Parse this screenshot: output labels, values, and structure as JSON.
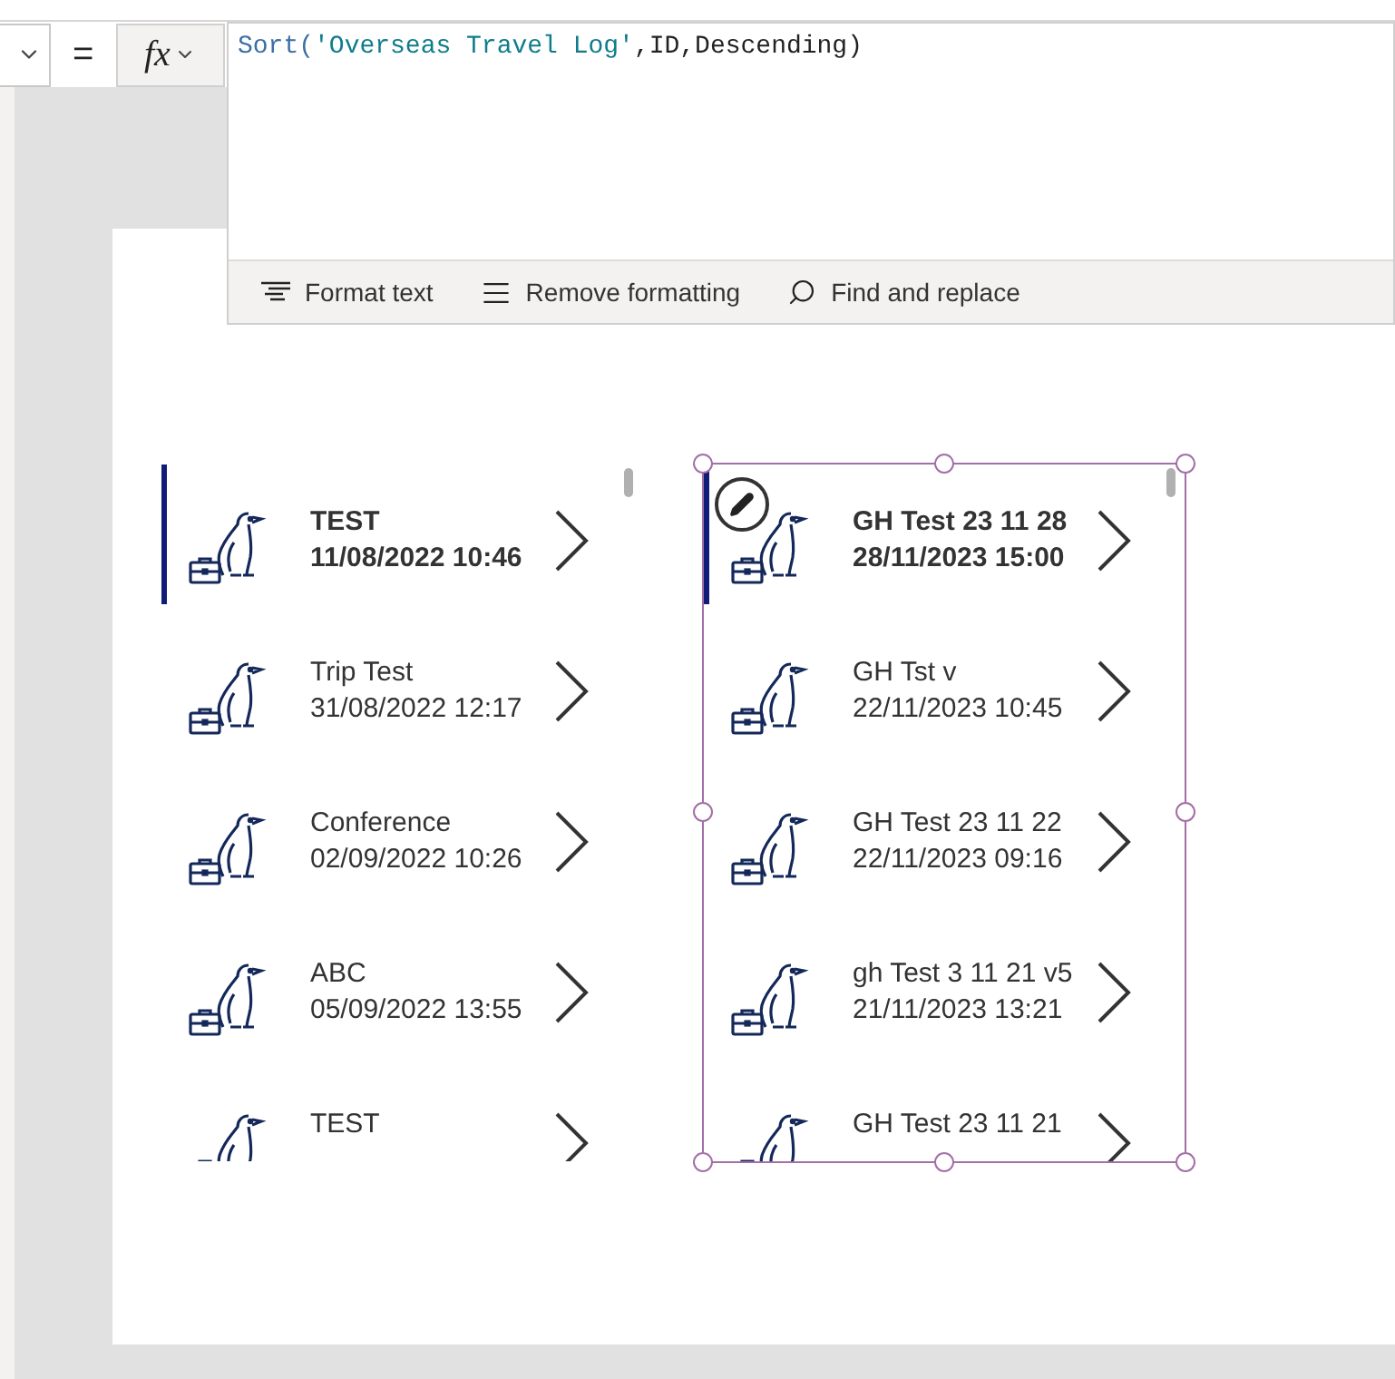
{
  "formula_bar": {
    "equals": "=",
    "fx": "fx",
    "formula": [
      {
        "kind": "function",
        "text": "Sort("
      },
      {
        "kind": "string",
        "text": "'Overseas Travel Log'"
      },
      {
        "kind": "plain",
        "text": ",ID,Descending)"
      }
    ],
    "toolbar": [
      "Format text",
      "Remove formatting",
      "Find and replace"
    ]
  },
  "galleries": [
    {
      "selected": false,
      "items": [
        {
          "title": "TEST",
          "date": "11/08/2022 10:46",
          "selected": true
        },
        {
          "title": "Trip Test",
          "date": "31/08/2022 12:17",
          "selected": false
        },
        {
          "title": "Conference",
          "date": "02/09/2022 10:26",
          "selected": false
        },
        {
          "title": "ABC",
          "date": "05/09/2022 13:55",
          "selected": false
        },
        {
          "title": "TEST",
          "selected": false
        }
      ]
    },
    {
      "selected": true,
      "items": [
        {
          "title": "GH Test 23 11 28",
          "date": "28/11/2023 15:00",
          "selected": true
        },
        {
          "title": "GH Tst v",
          "date": "22/11/2023 10:45",
          "selected": false
        },
        {
          "title": "GH Test 23 11 22",
          "date": "22/11/2023 09:16",
          "selected": false
        },
        {
          "title": "gh Test 3 11 21 v5",
          "date": "21/11/2023 13:21",
          "selected": false
        },
        {
          "title": "GH Test 23 11 21",
          "selected": false
        }
      ]
    }
  ]
}
